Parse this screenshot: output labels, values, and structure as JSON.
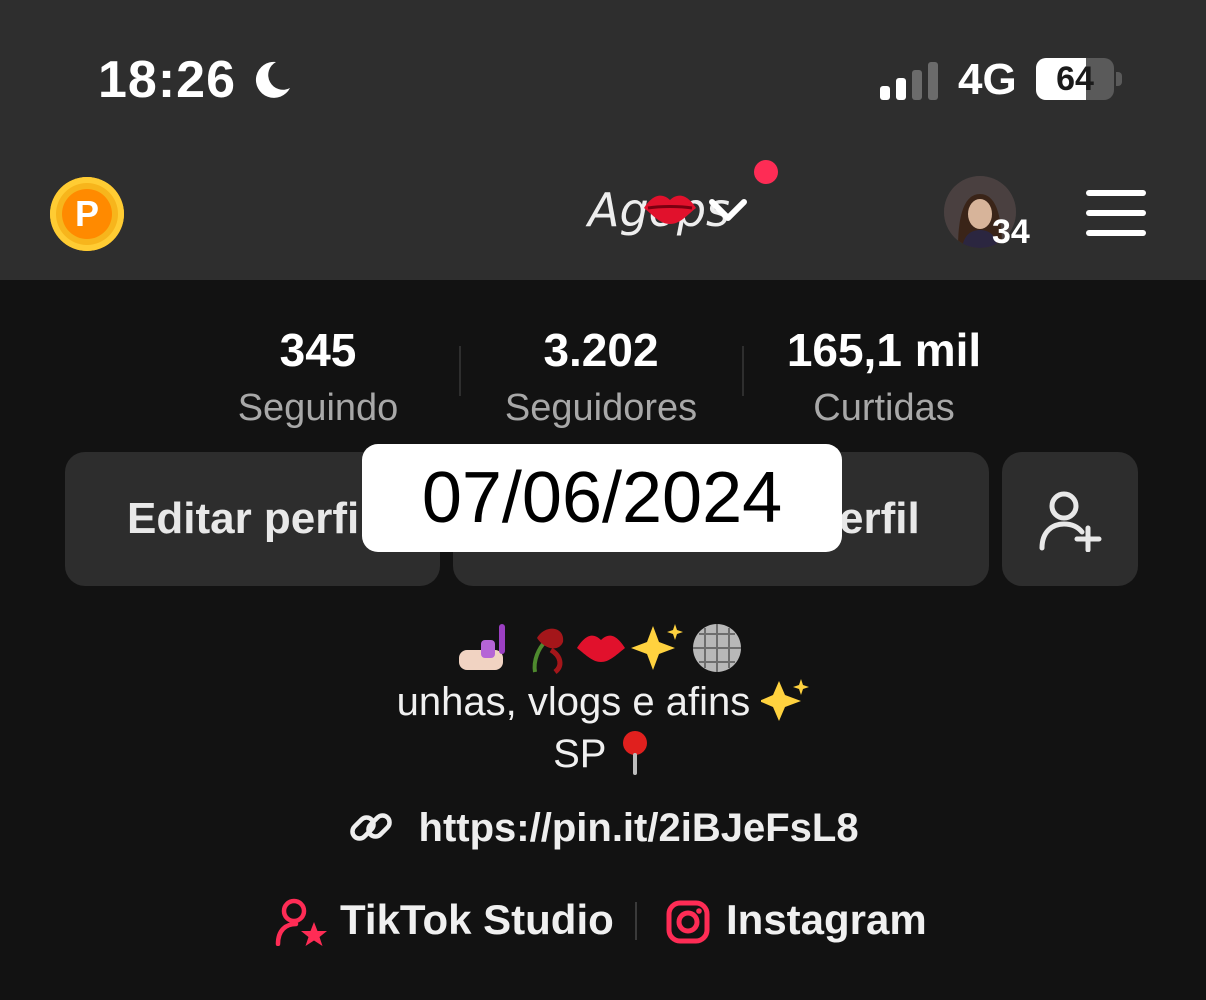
{
  "status_bar": {
    "time": "18:26",
    "network": "4G",
    "battery": "64",
    "battery_level": 0.64
  },
  "header": {
    "username": "Agops",
    "username_emoji": "kiss-lips",
    "avatar_badge_count": "34"
  },
  "stats": [
    {
      "value": "345",
      "label": "Seguindo"
    },
    {
      "value": "3.202",
      "label": "Seguidores"
    },
    {
      "value": "165,1 mil",
      "label": "Curtidas"
    }
  ],
  "buttons": {
    "edit_profile_visible": "Editar perfi",
    "share_profile_visible": "erfil"
  },
  "overlay": {
    "date": "07/06/2024"
  },
  "bio": {
    "line2": "unhas, vlogs e afins",
    "line3": "SP"
  },
  "profile_link": "https://pin.it/2iBJeFsL8",
  "bottom_links": {
    "studio": "TikTok Studio",
    "instagram": "Instagram"
  },
  "colors": {
    "accent": "#fe2c55",
    "coin": "#ff8a00"
  }
}
